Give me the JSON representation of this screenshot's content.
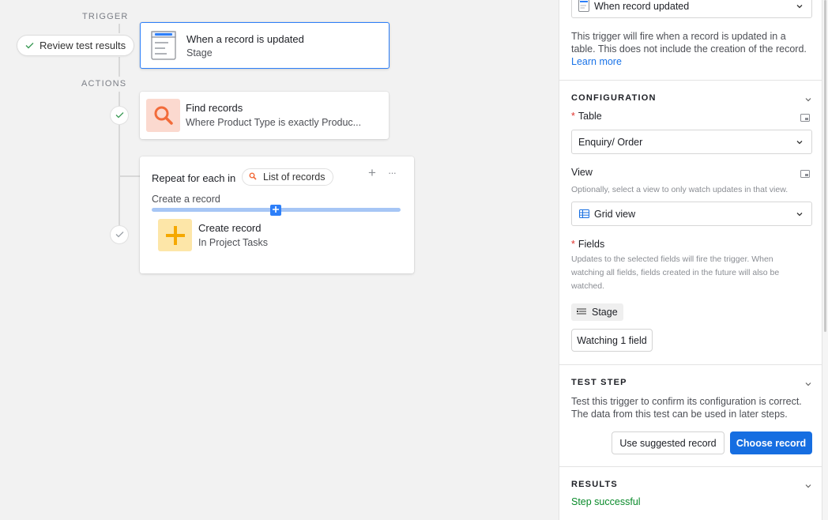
{
  "canvas": {
    "trigger_label": "TRIGGER",
    "actions_label": "ACTIONS",
    "review_button": "Review test results",
    "trigger_card": {
      "title": "When a record is updated",
      "subtitle": "Stage"
    },
    "find_card": {
      "title": "Find records",
      "subtitle": "Where Product Type is exactly Produc..."
    },
    "repeat_card": {
      "title": "Repeat for each in",
      "list_pill": "List of records",
      "create_label": "Create a record",
      "nested_title": "Create record",
      "nested_subtitle": "In Project Tasks",
      "add_glyph": "+",
      "more_glyph": "···"
    }
  },
  "panel": {
    "trigger_select": "When record updated",
    "trigger_description": "This trigger will fire when a record is updated in a table. This does not include the creation of the record.",
    "learn_more": "Learn more",
    "configuration_heading": "CONFIGURATION",
    "table_label": "Table",
    "table_value": "Enquiry/ Order",
    "view_label": "View",
    "view_help": "Optionally, select a view to only watch updates in that view.",
    "view_value": "Grid view",
    "fields_label": "Fields",
    "fields_help": "Updates to the selected fields will fire the trigger. When watching all fields, fields created in the future will also be watched.",
    "field_chip": "Stage",
    "watching_button": "Watching 1 field",
    "test_step_heading": "TEST STEP",
    "test_step_description": "Test this trigger to confirm its configuration is correct. The data from this test can be used in later steps.",
    "suggested_button": "Use suggested record",
    "choose_button": "Choose record",
    "results_heading": "RESULTS",
    "results_status": "Step successful",
    "required_mark": "*"
  },
  "colors": {
    "accent": "#2d7ff9",
    "primary_button": "#166ee1",
    "success": "#098a2a",
    "required": "#e0322d",
    "find_icon_bg": "#fbd9cf",
    "find_icon_fg": "#f26b3a",
    "create_icon_bg": "#fde6a8",
    "create_icon_fg": "#f5a800"
  },
  "icons": {
    "trigger": "record-updated-icon",
    "find": "search-icon",
    "create": "plus-icon",
    "view": "grid-icon",
    "field": "field-list-icon"
  }
}
